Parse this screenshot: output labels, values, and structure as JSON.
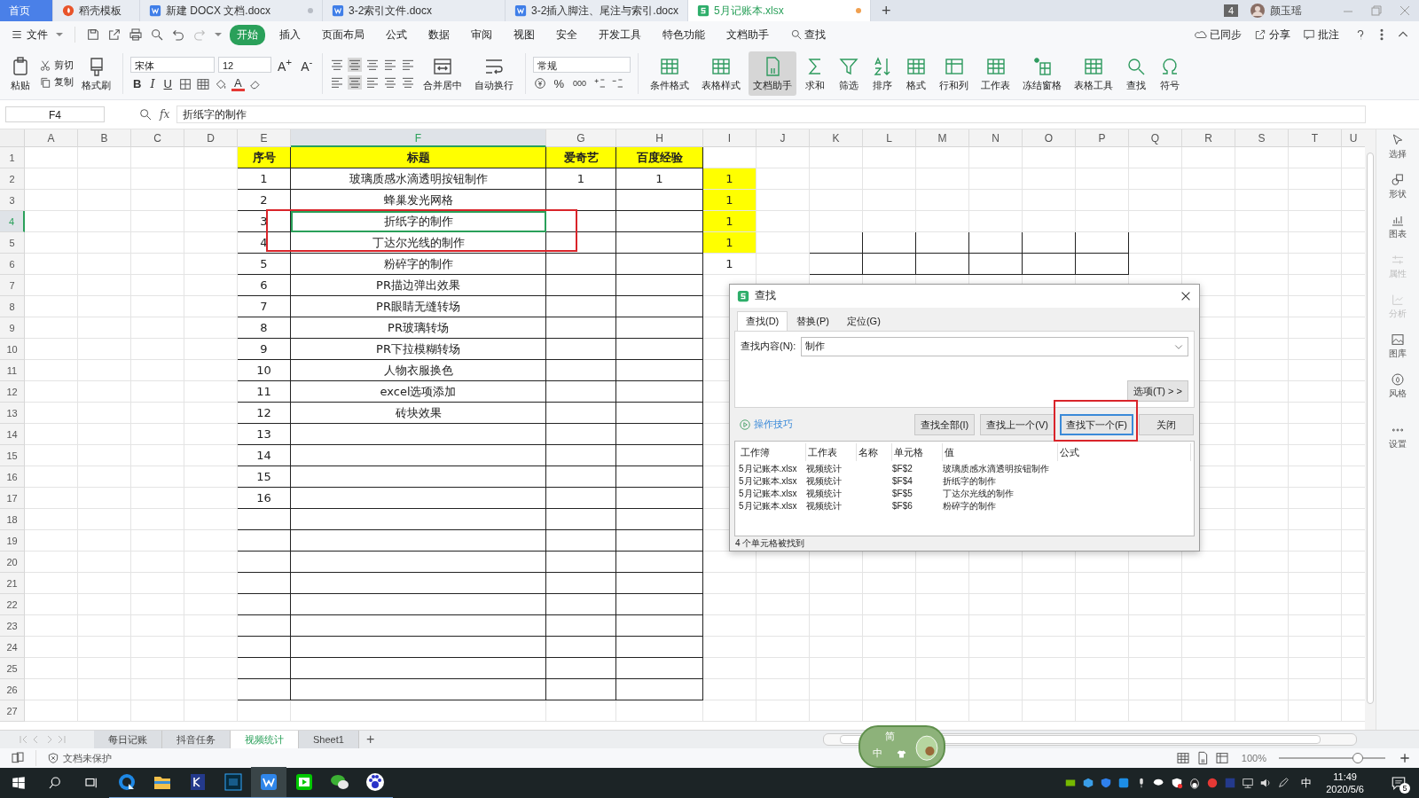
{
  "tabs": [
    {
      "label": "首页",
      "kind": "home",
      "selected": false,
      "modified": false
    },
    {
      "label": "稻壳模板",
      "kind": "template",
      "selected": false,
      "modified": false
    },
    {
      "label": "新建 DOCX 文档.docx",
      "kind": "doc",
      "selected": false,
      "modified": true
    },
    {
      "label": "3-2索引文件.docx",
      "kind": "doc",
      "selected": false,
      "modified": false
    },
    {
      "label": "3-2插入脚注、尾注与索引.docx",
      "kind": "doc",
      "selected": false,
      "modified": false
    },
    {
      "label": "5月记账本.xlsx",
      "kind": "sheet",
      "selected": true,
      "modified": true
    }
  ],
  "new_tab": "+",
  "window_count": "4",
  "user": "颜玉瑶",
  "menu": {
    "file": "文件",
    "items": [
      {
        "label": "开始",
        "selected": true,
        "kind": "tab"
      },
      {
        "label": "插入",
        "selected": false,
        "kind": "tab"
      },
      {
        "label": "页面布局",
        "selected": false,
        "kind": "tab"
      },
      {
        "label": "公式",
        "selected": false,
        "kind": "tab"
      },
      {
        "label": "数据",
        "selected": false,
        "kind": "tab"
      },
      {
        "label": "审阅",
        "selected": false,
        "kind": "tab"
      },
      {
        "label": "视图",
        "selected": false,
        "kind": "tab"
      },
      {
        "label": "安全",
        "selected": false,
        "kind": "tab"
      },
      {
        "label": "开发工具",
        "selected": false,
        "kind": "tab"
      },
      {
        "label": "特色功能",
        "selected": false,
        "kind": "tab"
      },
      {
        "label": "文档助手",
        "selected": false,
        "kind": "tab"
      },
      {
        "label": "查找",
        "selected": false,
        "kind": "search"
      }
    ],
    "right": [
      {
        "label": "已同步",
        "kind": "sync"
      },
      {
        "label": "分享",
        "kind": "share"
      },
      {
        "label": "批注",
        "kind": "comment"
      }
    ]
  },
  "ribbon": {
    "paste": "粘贴",
    "cut": "剪切",
    "copy": "复制",
    "painter": "格式刷",
    "font": "宋体",
    "size": "12",
    "grow": "A$^{+}$",
    "shrink": "A$^{-}$",
    "bold": "B",
    "italic": "I",
    "underline": "U",
    "font_color": "A",
    "merge": "合并居中",
    "wrap": "自动换行",
    "number_format": "常规",
    "percent": "%",
    "thousands": "000",
    "tools": [
      {
        "label": "条件格式",
        "on": false
      },
      {
        "label": "表格样式",
        "on": false
      },
      {
        "label": "文档助手",
        "on": true
      },
      {
        "label": "求和",
        "on": false
      },
      {
        "label": "筛选",
        "on": false
      },
      {
        "label": "排序",
        "on": false
      },
      {
        "label": "格式",
        "on": false
      },
      {
        "label": "行和列",
        "on": false
      },
      {
        "label": "工作表",
        "on": false
      },
      {
        "label": "冻结窗格",
        "on": false
      },
      {
        "label": "表格工具",
        "on": false
      },
      {
        "label": "查找",
        "on": false
      },
      {
        "label": "符号",
        "on": false
      }
    ]
  },
  "formula_bar": {
    "cell": "F4",
    "fx": "fx",
    "value": "折纸字的制作"
  },
  "sheet": {
    "callout": true,
    "columns": [
      {
        "label": "A",
        "selected": false
      },
      {
        "label": "B",
        "selected": false
      },
      {
        "label": "C",
        "selected": false
      },
      {
        "label": "D",
        "selected": false
      },
      {
        "label": "E",
        "selected": false
      },
      {
        "label": "F",
        "selected": true
      },
      {
        "label": "G",
        "selected": false
      },
      {
        "label": "H",
        "selected": false
      },
      {
        "label": "I",
        "selected": false
      },
      {
        "label": "J",
        "selected": false
      },
      {
        "label": "K",
        "selected": false
      },
      {
        "label": "L",
        "selected": false
      },
      {
        "label": "M",
        "selected": false
      },
      {
        "label": "N",
        "selected": false
      },
      {
        "label": "O",
        "selected": false
      },
      {
        "label": "P",
        "selected": false
      },
      {
        "label": "Q",
        "selected": false
      },
      {
        "label": "R",
        "selected": false
      },
      {
        "label": "S",
        "selected": false
      },
      {
        "label": "T",
        "selected": false
      },
      {
        "label": "U",
        "selected": false
      }
    ],
    "rows": [
      {
        "num": "1",
        "selected": false,
        "cells": {
          "E": {
            "text": "序号",
            "highlighted": true,
            "bold": true
          },
          "F": {
            "text": "标题",
            "highlighted": true,
            "bold": true
          },
          "G": {
            "text": "爱奇艺",
            "highlighted": true,
            "bold": true
          },
          "H": {
            "text": "百度经验",
            "highlighted": true,
            "bold": true
          }
        }
      },
      {
        "num": "2",
        "selected": false,
        "cells": {
          "E": {
            "text": "1",
            "highlighted": false
          },
          "F": {
            "text": "玻璃质感水滴透明按钮制作",
            "highlighted": false
          },
          "G": {
            "text": "1",
            "highlighted": false
          },
          "H": {
            "text": "1",
            "highlighted": false
          },
          "I": {
            "text": "1",
            "highlighted": true
          }
        }
      },
      {
        "num": "3",
        "selected": false,
        "cells": {
          "E": {
            "text": "2",
            "highlighted": false
          },
          "F": {
            "text": "蜂巢发光网格",
            "highlighted": false
          },
          "I": {
            "text": "1",
            "highlighted": true
          }
        }
      },
      {
        "num": "4",
        "selected": true,
        "cells": {
          "E": {
            "text": "3",
            "highlighted": false
          },
          "F": {
            "text": "折纸字的制作",
            "highlighted": false
          },
          "I": {
            "text": "1",
            "highlighted": true
          }
        }
      },
      {
        "num": "5",
        "selected": false,
        "cells": {
          "E": {
            "text": "4",
            "highlighted": false
          },
          "F": {
            "text": "丁达尔光线的制作",
            "highlighted": false
          },
          "I": {
            "text": "1",
            "highlighted": true
          }
        }
      },
      {
        "num": "6",
        "selected": false,
        "cells": {
          "E": {
            "text": "5",
            "highlighted": false
          },
          "F": {
            "text": "粉碎字的制作",
            "highlighted": false
          },
          "I": {
            "text": "1",
            "highlighted": false
          }
        }
      },
      {
        "num": "7",
        "selected": false,
        "cells": {
          "E": {
            "text": "6",
            "highlighted": false
          },
          "F": {
            "text": "PR描边弹出效果",
            "highlighted": false
          }
        }
      },
      {
        "num": "8",
        "selected": false,
        "cells": {
          "E": {
            "text": "7",
            "highlighted": false
          },
          "F": {
            "text": "PR眼睛无缝转场",
            "highlighted": false
          }
        }
      },
      {
        "num": "9",
        "selected": false,
        "cells": {
          "E": {
            "text": "8",
            "highlighted": false
          },
          "F": {
            "text": "PR玻璃转场",
            "highlighted": false
          }
        }
      },
      {
        "num": "10",
        "selected": false,
        "cells": {
          "E": {
            "text": "9",
            "highlighted": false
          },
          "F": {
            "text": "PR下拉模糊转场",
            "highlighted": false
          }
        }
      },
      {
        "num": "11",
        "selected": false,
        "cells": {
          "E": {
            "text": "10",
            "highlighted": false
          },
          "F": {
            "text": "人物衣服换色",
            "highlighted": false
          }
        }
      },
      {
        "num": "12",
        "selected": false,
        "cells": {
          "E": {
            "text": "11",
            "highlighted": false
          },
          "F": {
            "text": "excel选项添加",
            "highlighted": false
          }
        }
      },
      {
        "num": "13",
        "selected": false,
        "cells": {
          "E": {
            "text": "12",
            "highlighted": false
          },
          "F": {
            "text": "砖块效果",
            "highlighted": false
          }
        }
      },
      {
        "num": "14",
        "selected": false,
        "cells": {
          "E": {
            "text": "13",
            "highlighted": false
          }
        }
      },
      {
        "num": "15",
        "selected": false,
        "cells": {
          "E": {
            "text": "14",
            "highlighted": false
          }
        }
      },
      {
        "num": "16",
        "selected": false,
        "cells": {
          "E": {
            "text": "15",
            "highlighted": false
          }
        }
      },
      {
        "num": "17",
        "selected": false,
        "cells": {
          "E": {
            "text": "16",
            "highlighted": false
          }
        }
      },
      {
        "num": "18",
        "selected": false
      },
      {
        "num": "19",
        "selected": false
      },
      {
        "num": "20",
        "selected": false
      },
      {
        "num": "21",
        "selected": false
      },
      {
        "num": "22",
        "selected": false
      },
      {
        "num": "23",
        "selected": false
      },
      {
        "num": "24",
        "selected": false
      },
      {
        "num": "25",
        "selected": false
      },
      {
        "num": "26",
        "selected": false
      },
      {
        "num": "27",
        "selected": false
      }
    ]
  },
  "dialog": {
    "title": "查找",
    "tabs": [
      {
        "label": "查找(D)",
        "selected": true
      },
      {
        "label": "替换(P)",
        "selected": false
      },
      {
        "label": "定位(G)",
        "selected": false
      }
    ],
    "find_label": "查找内容(N):",
    "find_value": "制作",
    "options": "选项(T) > >",
    "tips": "操作技巧",
    "buttons": [
      {
        "label": "查找全部(I)",
        "focused": false,
        "callout": false
      },
      {
        "label": "查找上一个(V)",
        "focused": false,
        "callout": false
      },
      {
        "label": "查找下一个(F)",
        "focused": true,
        "callout": true
      },
      {
        "label": "关闭",
        "focused": false,
        "callout": false
      }
    ],
    "result_columns": [
      "工作簿",
      "工作表",
      "名称",
      "单元格",
      "值",
      "公式"
    ],
    "results": [
      {
        "workbook": "5月记账本.xlsx",
        "sheet": "视频统计",
        "cell": "$F$2",
        "value": "玻璃质感水滴透明按钮制作"
      },
      {
        "workbook": "5月记账本.xlsx",
        "sheet": "视频统计",
        "cell": "$F$4",
        "value": "折纸字的制作"
      },
      {
        "workbook": "5月记账本.xlsx",
        "sheet": "视频统计",
        "cell": "$F$5",
        "value": "丁达尔光线的制作"
      },
      {
        "workbook": "5月记账本.xlsx",
        "sheet": "视频统计",
        "cell": "$F$6",
        "value": "粉碎字的制作"
      }
    ],
    "status": "4 个单元格被找到"
  },
  "side_panel": [
    {
      "label": "选择",
      "disabled": false
    },
    {
      "label": "形状",
      "disabled": false
    },
    {
      "label": "图表",
      "disabled": false
    },
    {
      "label": "属性",
      "disabled": true
    },
    {
      "label": "分析",
      "disabled": true
    },
    {
      "label": "图库",
      "disabled": false
    },
    {
      "label": "风格",
      "disabled": false
    },
    {
      "label": "设置",
      "disabled": false
    }
  ],
  "sheet_tabs": [
    {
      "label": "每日记账",
      "selected": false
    },
    {
      "label": "抖音任务",
      "selected": false
    },
    {
      "label": "视频统计",
      "selected": true
    },
    {
      "label": "Sheet1",
      "selected": false
    }
  ],
  "add_sheet": "+",
  "status_bar": {
    "protection": "文档未保护",
    "zoom": "100%",
    "zoom_slider": {
      "level": 0.75
    }
  },
  "ime_bar": {
    "mode": "简",
    "lang": "中"
  },
  "taskbar": {
    "ime": "中",
    "time": "11:49",
    "date": "2020/5/6",
    "notifications": "5"
  }
}
